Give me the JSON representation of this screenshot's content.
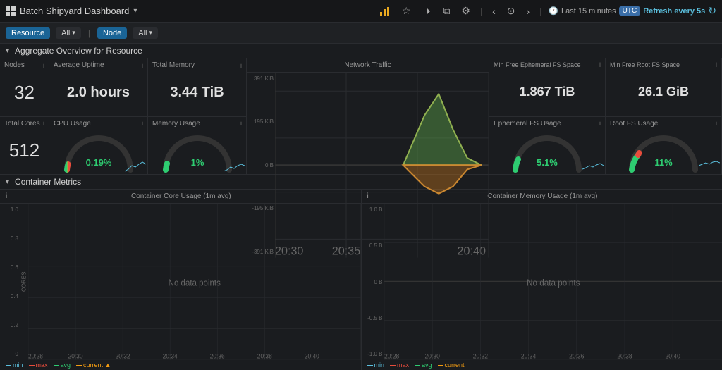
{
  "topNav": {
    "title": "Batch Shipyard Dashboard",
    "caret": "▾",
    "icons": [
      "chart",
      "star",
      "share",
      "copy",
      "gear",
      "chevron-left",
      "circle",
      "chevron-right"
    ],
    "refreshLabel": "Last 15 minutes",
    "refreshBadge": "UTC",
    "refreshActive": "Refresh every 5s",
    "refreshSpinIcon": "↻"
  },
  "filterBar": {
    "resource": "Resource",
    "all1": "All",
    "caret1": "▾",
    "node": "Node",
    "all2": "All",
    "caret2": "▾"
  },
  "aggregateSection": {
    "caret": "▾",
    "title": "Aggregate Overview for Resource"
  },
  "stats": {
    "nodes": {
      "label": "Nodes",
      "value": "32"
    },
    "totalCores": {
      "label": "Total Cores",
      "value": "512"
    },
    "avgUptime": {
      "label": "Average Uptime",
      "value": "2.0 hours"
    },
    "totalMemory": {
      "label": "Total Memory",
      "value": "3.44 TiB"
    },
    "cpuUsage": {
      "label": "CPU Usage",
      "value": "0.19%"
    },
    "memUsage": {
      "label": "Memory Usage",
      "value": "1%"
    },
    "minFreeEphFS": {
      "label": "Min Free Ephemeral FS Space",
      "value": "1.867 TiB"
    },
    "minFreeRootFS": {
      "label": "Min Free Root FS Space",
      "value": "26.1 GiB"
    },
    "ephFSUsage": {
      "label": "Ephemeral FS Usage",
      "value": "5.1%"
    },
    "rootFSUsage": {
      "label": "Root FS Usage",
      "value": "11%"
    }
  },
  "networkTraffic": {
    "label": "Network Traffic",
    "yLabels": [
      "391 KiB",
      "195 KiB",
      "0 B",
      "-195 KiB",
      "-391 KiB"
    ],
    "xLabels": [
      "20:30",
      "20:35",
      "20:40"
    ]
  },
  "containerMetrics": {
    "caret": "▾",
    "title": "Container Metrics",
    "coreChart": {
      "label": "Container Core Usage (1m avg)",
      "infoIcon": "i",
      "noData": "No data points",
      "yLabels": [
        "1.0",
        "0.8",
        "0.6",
        "0.4",
        "0.2",
        "0"
      ],
      "xLabels": [
        "20:28",
        "20:30",
        "20:32",
        "20:34",
        "20:36",
        "20:38",
        "20:40"
      ],
      "yAxisLabel": "CORES",
      "legend": [
        "min",
        "max",
        "avg",
        "current ▲"
      ]
    },
    "memChart": {
      "label": "Container Memory Usage (1m avg)",
      "infoIcon": "i",
      "noData": "No data points",
      "yLabels": [
        "1.0 B",
        "0.5 B",
        "0 B",
        "-0.5 B",
        "-1.0 B"
      ],
      "xLabels": [
        "20:28",
        "20:30",
        "20:32",
        "20:34",
        "20:36",
        "20:38",
        "20:40"
      ],
      "legend": [
        "min",
        "max",
        "avg",
        "current"
      ]
    }
  }
}
